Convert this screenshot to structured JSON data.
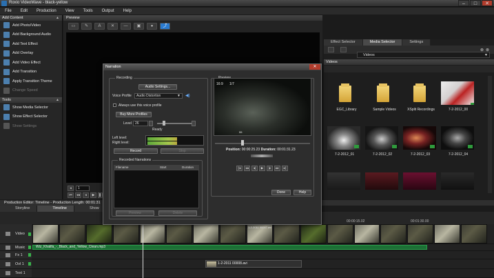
{
  "window": {
    "title": "Roxio VideoWave - black-yellow"
  },
  "menu": [
    "File",
    "Edit",
    "Production",
    "View",
    "Tools",
    "Output",
    "Help"
  ],
  "add_content": {
    "header": "Add Content",
    "items": [
      {
        "label": "Add Photo/Video",
        "icon": "film-icon"
      },
      {
        "label": "Add Background Audio",
        "icon": "music-note-icon"
      },
      {
        "label": "Add Text Effect",
        "icon": "text-icon"
      },
      {
        "label": "Add Overlay",
        "icon": "star-icon"
      },
      {
        "label": "Add Video Effect",
        "icon": "wand-icon"
      },
      {
        "label": "Add Transition",
        "icon": "transition-icon"
      },
      {
        "label": "Apply Transition Theme",
        "icon": "theme-icon"
      },
      {
        "label": "Change Speed",
        "icon": "speed-icon",
        "disabled": true
      }
    ]
  },
  "tools": {
    "header": "Tools",
    "items": [
      {
        "label": "Show Media Selector",
        "icon": "media-icon"
      },
      {
        "label": "Show Effect Selector",
        "icon": "effect-icon"
      },
      {
        "label": "Show Settings",
        "icon": "settings-icon",
        "disabled": true
      }
    ]
  },
  "preview": {
    "header": "Preview",
    "frame_value": "1"
  },
  "right": {
    "tabs": [
      "Effect Selector",
      "Media Selector",
      "Settings"
    ],
    "active_tab": "Media Selector",
    "location": "Videos",
    "section": "Videos",
    "media": [
      {
        "label": "EGC_Library",
        "kind": "folder"
      },
      {
        "label": "Sample Videos",
        "kind": "folder"
      },
      {
        "label": "XSplit Recordings",
        "kind": "folder"
      },
      {
        "label": "7-2-2012_00",
        "kind": "video"
      },
      {
        "label": "7-2-2012_01",
        "kind": "video"
      },
      {
        "label": "7-2-2012_02",
        "kind": "video"
      },
      {
        "label": "7-2-2012_03",
        "kind": "video"
      },
      {
        "label": "7-2-2012_04",
        "kind": "video"
      }
    ]
  },
  "timeline": {
    "header": "Production Editor: Timeline - Production Length: 00:01:31",
    "tabs": [
      "Storyline",
      "Timeline",
      "Show"
    ],
    "active_tab": "Timeline",
    "ruler": [
      "00:00:15.02",
      "00:01:30.00"
    ],
    "tracks": [
      "Video",
      "Music",
      "Fx 1",
      "Ovl 1",
      "Text 1"
    ],
    "music_clip": "Wiz_Khalifa_-_Black_and_Yellow_Clean.mp3",
    "overlay_clip": "1-2-2011 00008.avi",
    "video_clip_text": "1-2-2011 00007.avi"
  },
  "narration": {
    "title": "Narration",
    "recording_label": "Recording",
    "audio_settings": "Audio Settings...",
    "voice_profile_label": "Voice Profile",
    "voice_profile_value": "Audio Distortion",
    "always_use": "Always use this voice profile",
    "buy_more": "Buy More Profiles",
    "level_label": "Level",
    "level_value": "26",
    "ready": "Ready",
    "left_level": "Left level:",
    "right_level": "Right level:",
    "left_fill": 0.55,
    "right_fill": 0.55,
    "record": "Record",
    "stop": "Stop",
    "recorded_label": "Recorded Narrations",
    "columns": [
      "Filename",
      "Start",
      "Duration"
    ],
    "preview_btn": "Preview",
    "delete_btn": "Delete",
    "preview_label": "Preview",
    "position_label": "Position:",
    "position_value": "00:00:25.23",
    "duration_label": "Duration:",
    "duration_value": "00:01:31.23",
    "done": "Done",
    "help": "Help",
    "osd_left": "16:9",
    "osd_mid": "1/7",
    "osd_speed": "55"
  }
}
